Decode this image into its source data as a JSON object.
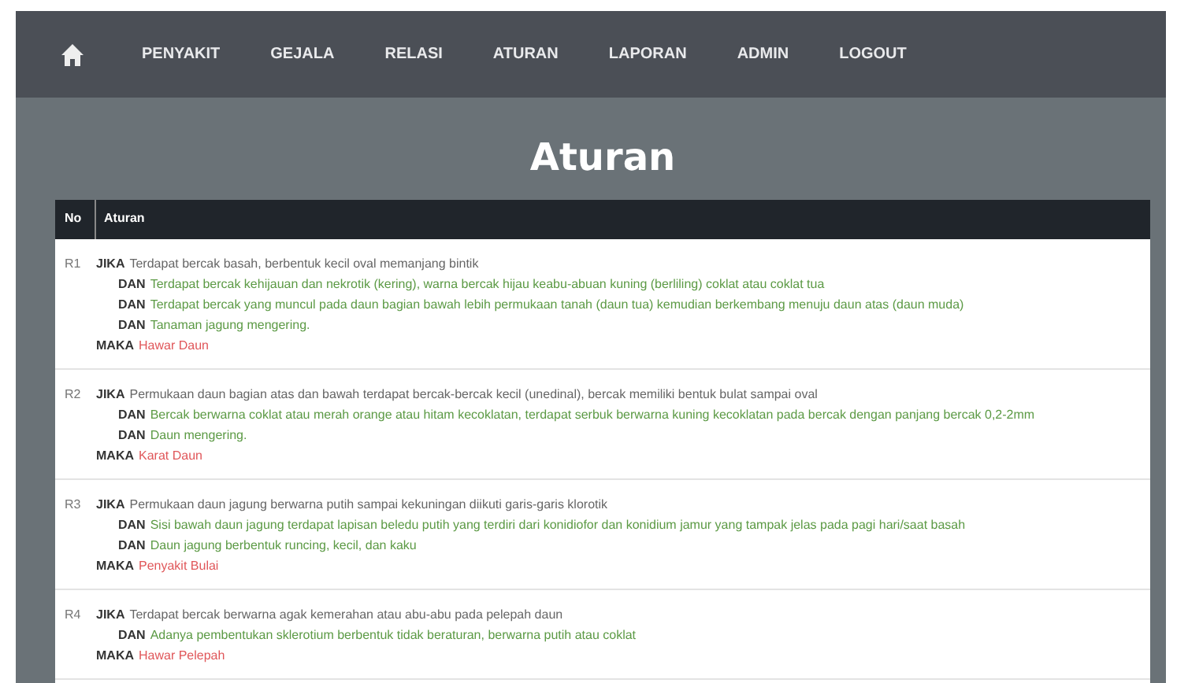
{
  "nav": {
    "items": [
      "PENYAKIT",
      "GEJALA",
      "RELASI",
      "ATURAN",
      "LAPORAN",
      "ADMIN",
      "LOGOUT"
    ]
  },
  "title": "Aturan",
  "table": {
    "columns": [
      "No",
      "Aturan"
    ],
    "rows": [
      {
        "no": "R1",
        "conditions": [
          {
            "op": "JIKA",
            "text": "Terdapat bercak basah, berbentuk kecil oval memanjang bintik"
          },
          {
            "op": "DAN",
            "text": "Terdapat bercak kehijauan dan nekrotik (kering), warna bercak hijau keabu-abuan kuning (berliling) coklat atau coklat tua"
          },
          {
            "op": "DAN",
            "text": "Terdapat bercak yang muncul pada daun bagian bawah lebih permukaan tanah (daun tua) kemudian berkembang menuju daun atas (daun muda)"
          },
          {
            "op": "DAN",
            "text": "Tanaman jagung mengering."
          }
        ],
        "conclusion": {
          "op": "MAKA",
          "text": "Hawar Daun"
        }
      },
      {
        "no": "R2",
        "conditions": [
          {
            "op": "JIKA",
            "text": "Permukaan daun bagian atas dan bawah terdapat bercak-bercak kecil (unedinal), bercak memiliki bentuk bulat sampai oval"
          },
          {
            "op": "DAN",
            "text": "Bercak berwarna coklat atau merah orange atau hitam kecoklatan, terdapat serbuk berwarna kuning kecoklatan pada bercak dengan panjang bercak 0,2-2mm"
          },
          {
            "op": "DAN",
            "text": "Daun mengering."
          }
        ],
        "conclusion": {
          "op": "MAKA",
          "text": "Karat Daun"
        }
      },
      {
        "no": "R3",
        "conditions": [
          {
            "op": "JIKA",
            "text": "Permukaan daun jagung berwarna putih sampai kekuningan diikuti garis-garis klorotik"
          },
          {
            "op": "DAN",
            "text": "Sisi bawah daun jagung terdapat lapisan beledu putih yang terdiri dari konidiofor dan konidium jamur yang tampak jelas pada pagi hari/saat basah"
          },
          {
            "op": "DAN",
            "text": "Daun jagung berbentuk runcing, kecil, dan kaku"
          }
        ],
        "conclusion": {
          "op": "MAKA",
          "text": "Penyakit Bulai"
        }
      },
      {
        "no": "R4",
        "conditions": [
          {
            "op": "JIKA",
            "text": "Terdapat bercak berwarna agak kemerahan atau abu-abu pada pelepah daun"
          },
          {
            "op": "DAN",
            "text": "Adanya pembentukan sklerotium berbentuk tidak beraturan, berwarna putih atau coklat"
          }
        ],
        "conclusion": {
          "op": "MAKA",
          "text": "Hawar Pelepah"
        }
      }
    ]
  }
}
